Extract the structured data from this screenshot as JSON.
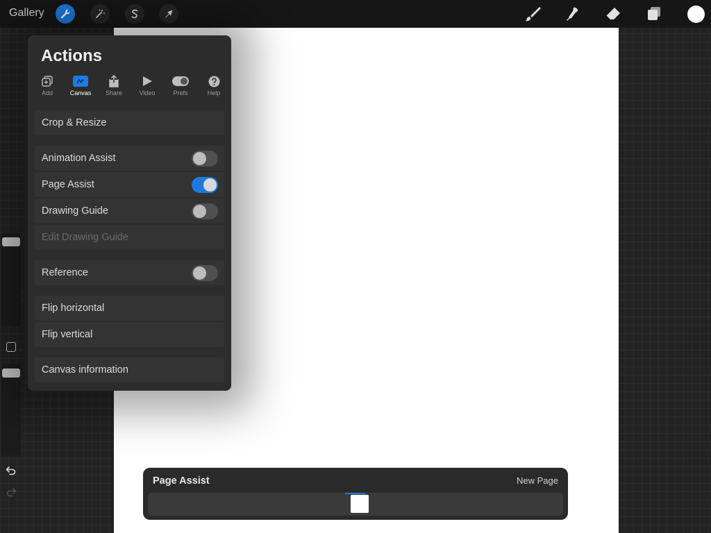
{
  "topbar": {
    "gallery_label": "Gallery",
    "left_tools": [
      {
        "name": "actions",
        "icon": "wrench-icon",
        "active": true
      },
      {
        "name": "adjustments",
        "icon": "magic-wand-icon",
        "active": false
      },
      {
        "name": "selection",
        "icon": "selection-s-icon",
        "active": false
      },
      {
        "name": "transform",
        "icon": "arrow-cursor-icon",
        "active": false
      }
    ],
    "right_tools": [
      {
        "name": "brush",
        "icon": "brush-icon"
      },
      {
        "name": "smudge",
        "icon": "smudge-icon"
      },
      {
        "name": "eraser",
        "icon": "eraser-icon"
      },
      {
        "name": "layers",
        "icon": "layers-icon"
      }
    ],
    "current_color": "#ffffff"
  },
  "actions_panel": {
    "title": "Actions",
    "tabs": [
      {
        "label": "Add",
        "icon": "add-icon",
        "active": false
      },
      {
        "label": "Canvas",
        "icon": "canvas-icon",
        "active": true
      },
      {
        "label": "Share",
        "icon": "share-icon",
        "active": false
      },
      {
        "label": "Video",
        "icon": "play-icon",
        "active": false
      },
      {
        "label": "Prefs",
        "icon": "toggle-icon",
        "active": false
      },
      {
        "label": "Help",
        "icon": "help-icon",
        "active": false
      }
    ],
    "rows": {
      "crop_resize": "Crop & Resize",
      "animation_assist": "Animation Assist",
      "page_assist": "Page Assist",
      "drawing_guide": "Drawing Guide",
      "edit_drawing_guide": "Edit Drawing Guide",
      "reference": "Reference",
      "flip_horizontal": "Flip horizontal",
      "flip_vertical": "Flip vertical",
      "canvas_information": "Canvas information"
    },
    "toggles": {
      "animation_assist": false,
      "page_assist": true,
      "drawing_guide": false,
      "reference": false
    }
  },
  "page_assist_bar": {
    "title": "Page Assist",
    "new_page_label": "New Page",
    "pages": 1,
    "selected_page": 1
  },
  "colors": {
    "accent": "#1f7ae0",
    "panel": "#2c2c2c",
    "canvas": "#ffffff"
  }
}
